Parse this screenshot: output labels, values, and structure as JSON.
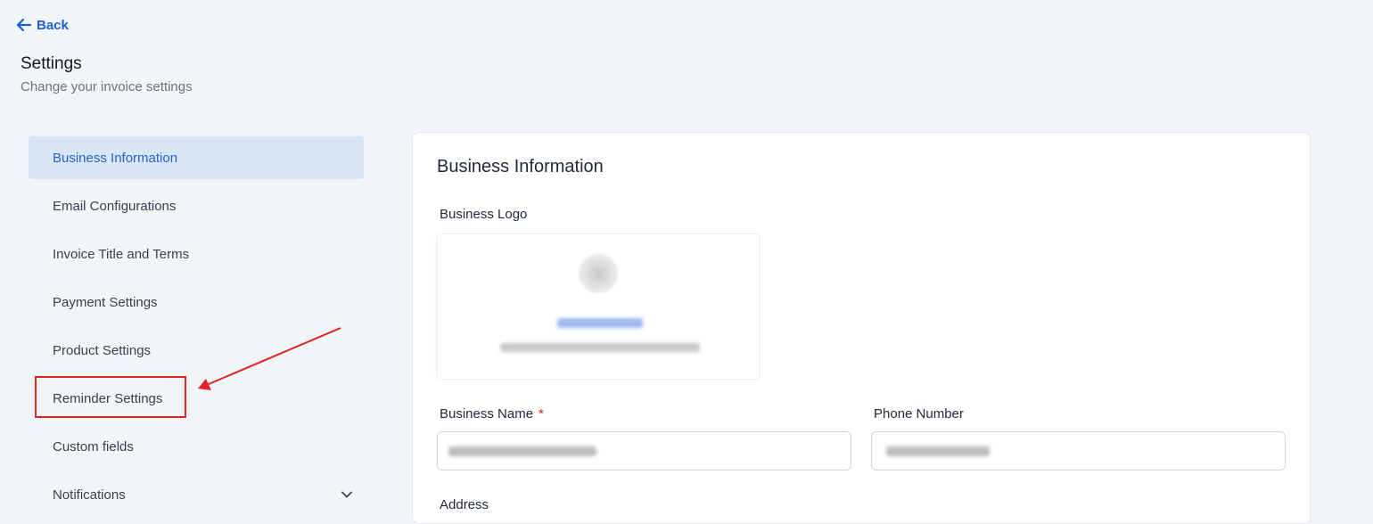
{
  "header": {
    "back_label": "Back",
    "title": "Settings",
    "subtitle": "Change your invoice settings"
  },
  "sidebar": {
    "items": [
      {
        "label": "Business Information",
        "active": true
      },
      {
        "label": "Email Configurations"
      },
      {
        "label": "Invoice Title and Terms"
      },
      {
        "label": "Payment Settings"
      },
      {
        "label": "Product Settings"
      },
      {
        "label": "Reminder Settings",
        "highlighted": true
      },
      {
        "label": "Custom fields"
      },
      {
        "label": "Notifications",
        "expandable": true
      }
    ]
  },
  "panel": {
    "title": "Business Information",
    "logo_label": "Business Logo",
    "business_name_label": "Business Name",
    "required_marker": "*",
    "phone_label": "Phone Number",
    "address_label": "Address"
  },
  "colors": {
    "accent": "#1d5fd6",
    "active_bg": "#d9e6f8",
    "annotation": "#e02424",
    "page_bg": "#f2f6f9"
  }
}
